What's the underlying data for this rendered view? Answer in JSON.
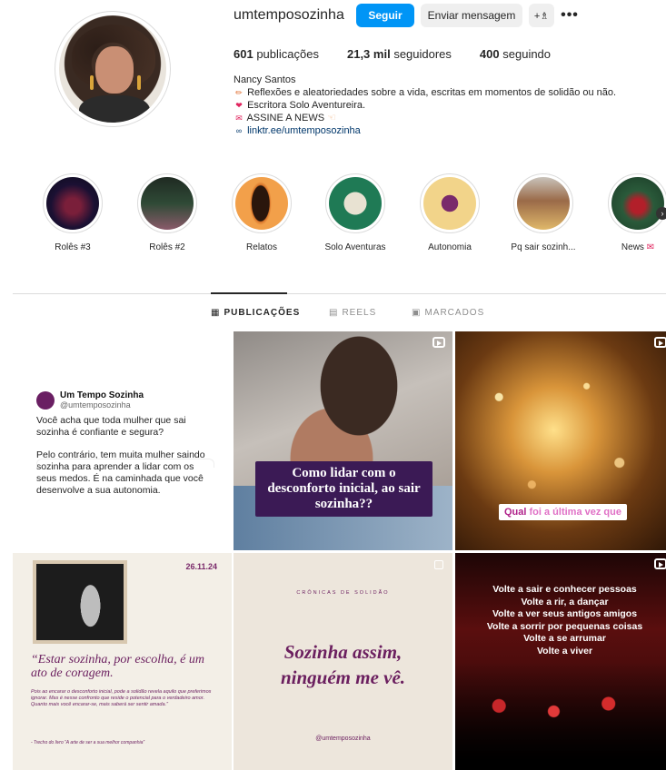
{
  "profile": {
    "username": "umtemposozinha",
    "follow_label": "Seguir",
    "message_label": "Enviar mensagem",
    "add_user_icon": "+♗",
    "more_icon": "•••",
    "stats": {
      "posts_count": "601",
      "posts_label": "publicações",
      "followers_count": "21,3 mil",
      "followers_label": "seguidores",
      "following_count": "400",
      "following_label": "seguindo"
    },
    "bio": {
      "name": "Nancy Santos",
      "line1": "Reflexões e aleatoriedades sobre a vida, escritas em momentos de solidão ou não.",
      "line1_icon": "pencil-icon",
      "line2": "Escritora Solo Aventureira.",
      "line2_icon": "heart-icon",
      "line3": "ASSINE A NEWS",
      "line3_icon": "love-letter-icon",
      "line3_trailing_icon": "pointing-hand-icon",
      "link": "linktr.ee/umtemposozinha"
    }
  },
  "highlights": [
    {
      "label": "Rolês #3"
    },
    {
      "label": "Rolês #2"
    },
    {
      "label": "Relatos"
    },
    {
      "label": "Solo Aventuras"
    },
    {
      "label": "Autonomia"
    },
    {
      "label": "Pq sair sozinh..."
    },
    {
      "label": "News"
    }
  ],
  "tabs": [
    {
      "label": "PUBLICAÇÕES",
      "icon": "grid-icon",
      "active": true
    },
    {
      "label": "REELS",
      "icon": "reels-icon",
      "active": false
    },
    {
      "label": "MARCADOS",
      "icon": "tagged-icon",
      "active": false
    }
  ],
  "posts": {
    "p1": {
      "name": "Um Tempo Sozinha",
      "handle": "@umtemposozinha",
      "para1": "Você acha que toda mulher que sai sozinha é confiante e segura?",
      "para2": "Pelo contrário, tem muita mulher saindo sozinha para aprender a lidar com os seus medos. É na caminhada que você desenvolve a sua autonomia."
    },
    "p2": {
      "caption": "Como lidar com o desconforto inicial, ao sair sozinha??"
    },
    "p3": {
      "q_part1": "Qual",
      "q_part2": "foi a última vez que"
    },
    "p4": {
      "date": "26.11.24",
      "quote": "“Estar sozinha, por escolha, é um ato de coragem.",
      "small": "Pois ao encarar o desconforto inicial, pode a solidão revela aquilo que preferimos ignorar. Mas é nesse confronto que reside o potencial para o verdadeiro amor. Quanto mais você encarar-se, mais saberá ser sentir amada.”",
      "source": "- Trecho do livro “A arte de ser a sua melhor companhia”"
    },
    "p5": {
      "top": "CRÔNICAS DE SOLIDÃO",
      "line1": "Sozinha assim,",
      "line2": "ninguém me vê.",
      "handle": "@umtemposozinha"
    },
    "p6": {
      "lines": [
        "Volte a sair e conhecer pessoas",
        "Volte a rir, a dançar",
        "Volte a ver seus antigos amigos",
        "Volte a sorrir por pequenas coisas",
        "Volte a se arrumar",
        "Volte a viver"
      ]
    }
  },
  "colors": {
    "follow_blue": "#0095f6",
    "link_blue": "#00376b",
    "brand_purple": "#6b1f5f"
  }
}
